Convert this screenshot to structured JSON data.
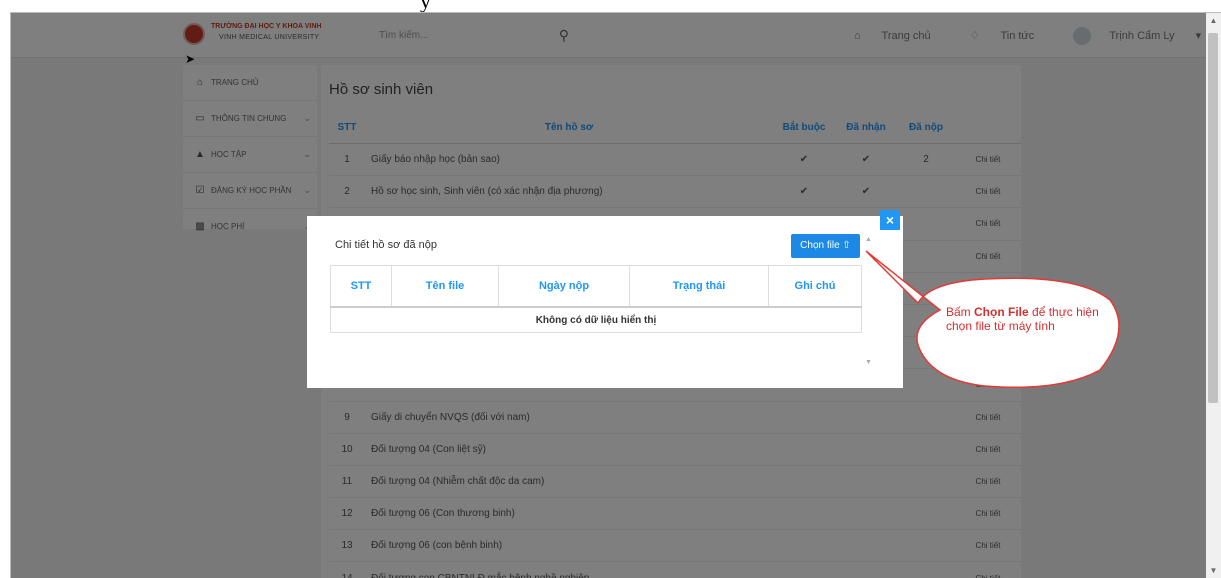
{
  "document": {
    "caption_fragment": "y"
  },
  "navbar": {
    "logo_line1": "TRƯỜNG ĐẠI HỌC Y KHOA VINH",
    "logo_line2": "VINH MEDICAL UNIVERSITY",
    "search_placeholder": "Tìm kiếm...",
    "home_label": "Trang chủ",
    "notifications_label": "Tin tức",
    "user_name": "Trịnh Cẩm Ly"
  },
  "sidebar": {
    "items": [
      {
        "label": "TRANG CHỦ",
        "icon": "home-icon"
      },
      {
        "label": "THÔNG TIN CHUNG",
        "icon": "monitor-icon"
      },
      {
        "label": "HỌC TẬP",
        "icon": "graduation-cap-icon"
      },
      {
        "label": "ĐĂNG KÝ HỌC PHẦN",
        "icon": "check-square-icon"
      },
      {
        "label": "HỌC PHÍ",
        "icon": "money-icon"
      }
    ]
  },
  "main": {
    "title": "Hồ sơ sinh viên",
    "columns": [
      "STT",
      "Tên hồ sơ",
      "Bắt buộc",
      "Đã nhận",
      "Đã nộp",
      ""
    ],
    "action_label": "Chi tiết",
    "rows": [
      {
        "stt": "1",
        "name": "Giấy báo nhập học (bản sao)",
        "required": true,
        "received": true,
        "submitted": "2"
      },
      {
        "stt": "2",
        "name": "Hồ sơ học sinh, Sinh viên (có xác nhận địa phương)",
        "required": true,
        "received": true,
        "submitted": ""
      },
      {
        "stt": "",
        "name": "",
        "required": false,
        "received": false,
        "submitted": ""
      },
      {
        "stt": "",
        "name": "",
        "required": false,
        "received": false,
        "submitted": ""
      },
      {
        "stt": "",
        "name": "",
        "required": false,
        "received": false,
        "submitted": ""
      },
      {
        "stt": "",
        "name": "",
        "required": false,
        "received": false,
        "submitted": ""
      },
      {
        "stt": "",
        "name": "",
        "required": false,
        "received": false,
        "submitted": ""
      },
      {
        "stt": "",
        "name": "",
        "required": false,
        "received": false,
        "submitted": ""
      },
      {
        "stt": "9",
        "name": "Giấy di chuyển NVQS (đối với nam)",
        "required": false,
        "received": false,
        "submitted": ""
      },
      {
        "stt": "10",
        "name": "Đối tượng 04 (Con liệt sỹ)",
        "required": false,
        "received": false,
        "submitted": ""
      },
      {
        "stt": "11",
        "name": "Đối tượng 04 (Nhiễm chất độc da cam)",
        "required": false,
        "received": false,
        "submitted": ""
      },
      {
        "stt": "12",
        "name": "Đối tượng 06 (Con thương binh)",
        "required": false,
        "received": false,
        "submitted": ""
      },
      {
        "stt": "13",
        "name": "Đối tượng 06 (con bệnh binh)",
        "required": false,
        "received": false,
        "submitted": ""
      },
      {
        "stt": "14",
        "name": "Đối tượng con CBNTNLĐ mắc bệnh nghề nghiệp",
        "required": false,
        "received": false,
        "submitted": ""
      }
    ]
  },
  "modal": {
    "title": "Chi tiết hồ sơ đã nộp",
    "close_label": "×",
    "upload_label": "Chọn file",
    "columns": [
      "STT",
      "Tên file",
      "Ngày nộp",
      "Trạng thái",
      "Ghi chú"
    ],
    "empty_message": "Không có dữ liệu hiển thị"
  },
  "callout": {
    "prefix": "Bấm ",
    "highlight": "Chọn File",
    "suffix": " để thực hiện chọn file từ máy tính"
  },
  "colors": {
    "accent": "#2196f3",
    "callout_border": "#e53935",
    "callout_text": "#d32f2f",
    "check": "#4caf50"
  }
}
